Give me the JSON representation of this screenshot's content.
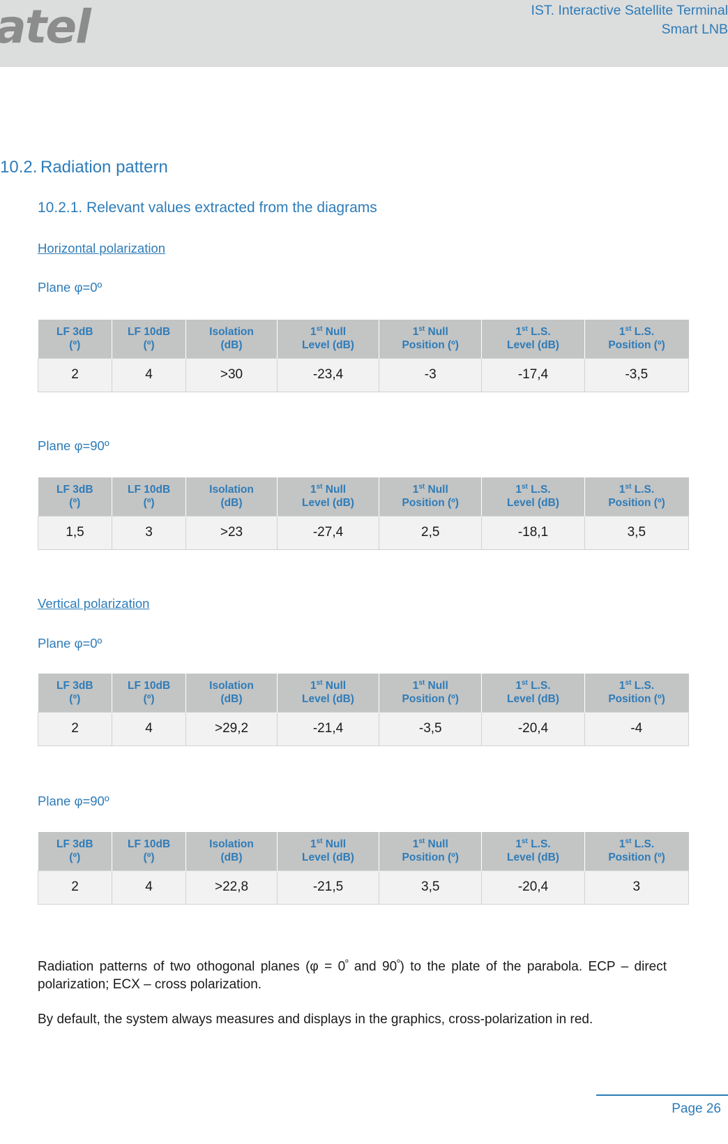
{
  "header": {
    "logo_text": "gatel",
    "title_line1": "IST. Interactive Satellite Terminal",
    "title_line2": "Smart LNB"
  },
  "section": {
    "number": "10.2.",
    "title": "Radiation pattern",
    "subsection": "10.2.1. Relevant values extracted from the diagrams"
  },
  "blocks": [
    {
      "polarization": "Horizontal polarization",
      "plane": "Plane φ=0º"
    },
    {
      "plane": "Plane φ=90º"
    },
    {
      "polarization": "Vertical polarization",
      "plane": "Plane φ=0º"
    },
    {
      "plane": "Plane φ=90º"
    }
  ],
  "table_headers": [
    {
      "l1": "LF 3dB",
      "l2": "(º)",
      "sup": ""
    },
    {
      "l1": "LF 10dB",
      "l2": "(º)",
      "sup": ""
    },
    {
      "l1": "Isolation",
      "l2": "(dB)",
      "sup": ""
    },
    {
      "l1": "1",
      "sup": "st",
      "l1b": " Null",
      "l2": "Level  (dB)"
    },
    {
      "l1": "1",
      "sup": "st",
      "l1b": " Null",
      "l2": "Position (º)"
    },
    {
      "l1": "1",
      "sup": "st",
      "l1b": " L.S.",
      "l2": "Level  (dB)"
    },
    {
      "l1": "1",
      "sup": "st",
      "l1b": " L.S.",
      "l2": "Position (º)"
    }
  ],
  "tables": [
    {
      "name": "horizontal-plane-0",
      "values": [
        "2",
        "4",
        ">30",
        "-23,4",
        "-3",
        "-17,4",
        "-3,5"
      ]
    },
    {
      "name": "horizontal-plane-90",
      "values": [
        "1,5",
        "3",
        ">23",
        "-27,4",
        "2,5",
        "-18,1",
        "3,5"
      ]
    },
    {
      "name": "vertical-plane-0",
      "values": [
        "2",
        "4",
        ">29,2",
        "-21,4",
        "-3,5",
        "-20,4",
        "-4"
      ]
    },
    {
      "name": "vertical-plane-90",
      "values": [
        "2",
        "4",
        ">22,8",
        "-21,5",
        "3,5",
        "-20,4",
        "3"
      ]
    }
  ],
  "paragraphs": {
    "p1_a": "Radiation patterns of two othogonal planes (φ = 0",
    "p1_ord1": "º",
    "p1_b": " and 90",
    "p1_ord2": "º",
    "p1_c": ") to the plate of the parabola. ECP – direct polarization; ECX – cross polarization.",
    "p2": "By default, the system always measures and displays in the graphics, cross-polarization in red."
  },
  "footer": {
    "page": "Page 26"
  }
}
